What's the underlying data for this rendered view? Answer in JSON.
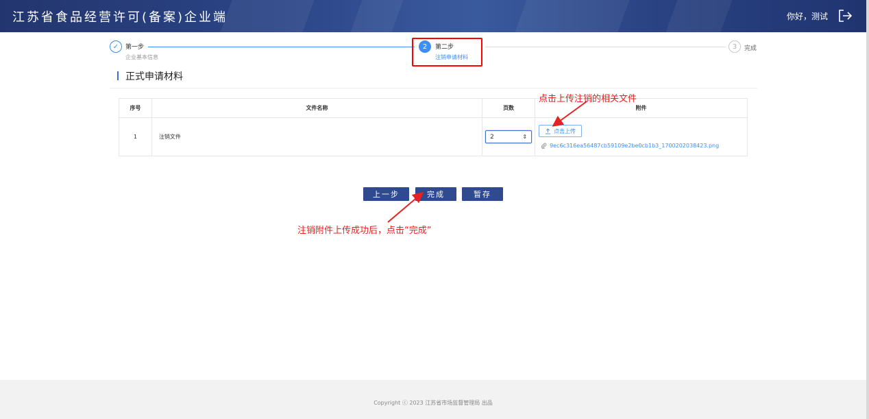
{
  "header": {
    "title": "江苏省食品经营许可(备案)企业端",
    "greeting": "你好，测试",
    "logout_icon": "logout-icon"
  },
  "steps": [
    {
      "number": "✓",
      "label": "第一步",
      "sub": "企业基本信息",
      "status": "done"
    },
    {
      "number": "2",
      "label": "第二步",
      "sub": "注销申请材料",
      "status": "active"
    },
    {
      "number": "3",
      "label": "完成",
      "sub": "",
      "status": "pending"
    }
  ],
  "section": {
    "title": "正式申请材料"
  },
  "table": {
    "headers": {
      "no": "序号",
      "name": "文件名称",
      "pages": "页数",
      "attachment": "附件"
    },
    "rows": [
      {
        "no": "1",
        "name": "注销文件",
        "pages": "2",
        "upload_label": "点击上传",
        "file": "9ec6c316ea56487cb59109e2be0cb1b3_1700202038423.png"
      }
    ]
  },
  "buttons": {
    "prev": "上一步",
    "done": "完成",
    "save": "暂存"
  },
  "annotations": {
    "upload_hint": "点击上传注销的相关文件",
    "done_hint": "注销附件上传成功后，点击“完成”"
  },
  "footer": {
    "copyright": "Copyright ⓒ 2023 江苏省市场监督管理局 出品"
  },
  "colors": {
    "header": "#2b4485",
    "accent": "#3d8ef5",
    "button": "#2f4a8f",
    "annotation": "#e8201f"
  }
}
